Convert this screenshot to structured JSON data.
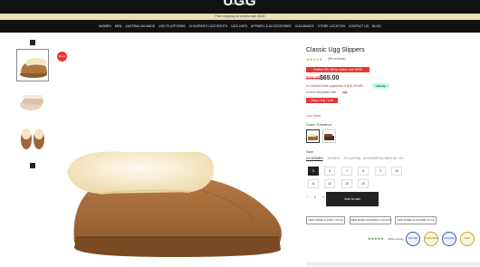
{
  "header": {
    "logo_text": "UGG",
    "logo_sub": "australia classic",
    "promo": "Free shipping on orders over $100"
  },
  "nav": {
    "items": [
      "WOMEN",
      "MEN",
      "AUSTRALIAN MADE",
      "UGG PLATFORMS",
      "CHILDREN'S UGG BOOTS",
      "UGG HATS",
      "APPAREL & ACCESSORIES",
      "CLEARANCE",
      "STORE LOCATION",
      "CONTACT US",
      "BLOG"
    ]
  },
  "gallery": {
    "badge": "SALE"
  },
  "product": {
    "title": "Classic Ugg Slippers",
    "stars": "★★★★★",
    "reviews": "(59 reviews)",
    "offer": "Further 5% Off for orders over $200",
    "price_old": "$79.00",
    "price_new": "$65.00",
    "afterpay_text": "or 4 interest-free payments of $16.25 with",
    "afterpay_logo": "afterpay",
    "zip_text": "or from $10/week with",
    "zip_logo": "zip",
    "hurry": "Hurry, Only 7 Left",
    "stock": "Low Stock",
    "color_label": "Color: Chestnut",
    "size_label": "Size",
    "size_tabs": [
      "US WOMEN",
      "US MEN",
      "EU (ULTRA)",
      "AU WOMEN",
      "AU MEN",
      "UK",
      "EU"
    ],
    "sizes": [
      "5",
      "6",
      "7",
      "8",
      "9",
      "10",
      "11",
      "12",
      "13",
      "14"
    ],
    "qty_minus": "−",
    "qty_value": "1",
    "qty_plus": "+",
    "add_to_cart": "Add to cart",
    "options": [
      "VIEW MORE CLASSIC STYLE",
      "VIEW MORE SLIPPERS & SCUFFS",
      "VIEW MORE PLATFORM STYLE"
    ],
    "trust_stars": "★★★★★",
    "trust_text": "4452 reviews",
    "seals": [
      "SECURE",
      "GUARANTEE",
      "GENUINE",
      "AUST"
    ]
  },
  "colors": {
    "accent": "#e53935",
    "chestnut": "#a0673a",
    "wool": "#f4e6bf"
  }
}
